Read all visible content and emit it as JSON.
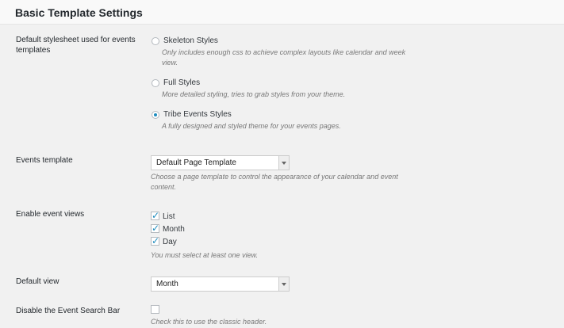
{
  "section": {
    "title": "Basic Template Settings"
  },
  "stylesheet": {
    "label": "Default stylesheet used for events templates",
    "options": [
      {
        "label": "Skeleton Styles",
        "description": "Only includes enough css to achieve complex layouts like calendar and week view.",
        "checked": false
      },
      {
        "label": "Full Styles",
        "description": "More detailed styling, tries to grab styles from your theme.",
        "checked": false
      },
      {
        "label": "Tribe Events Styles",
        "description": "A fully designed and styled theme for your events pages.",
        "checked": true
      }
    ]
  },
  "events_template": {
    "label": "Events template",
    "selected": "Default Page Template",
    "description": "Choose a page template to control the appearance of your calendar and event content."
  },
  "event_views": {
    "label": "Enable event views",
    "options": [
      {
        "label": "List",
        "checked": true
      },
      {
        "label": "Month",
        "checked": true
      },
      {
        "label": "Day",
        "checked": true
      }
    ],
    "description": "You must select at least one view."
  },
  "default_view": {
    "label": "Default view",
    "selected": "Month"
  },
  "search_bar": {
    "label": "Disable the Event Search Bar",
    "checked": false,
    "description": "Check this to use the classic header."
  }
}
